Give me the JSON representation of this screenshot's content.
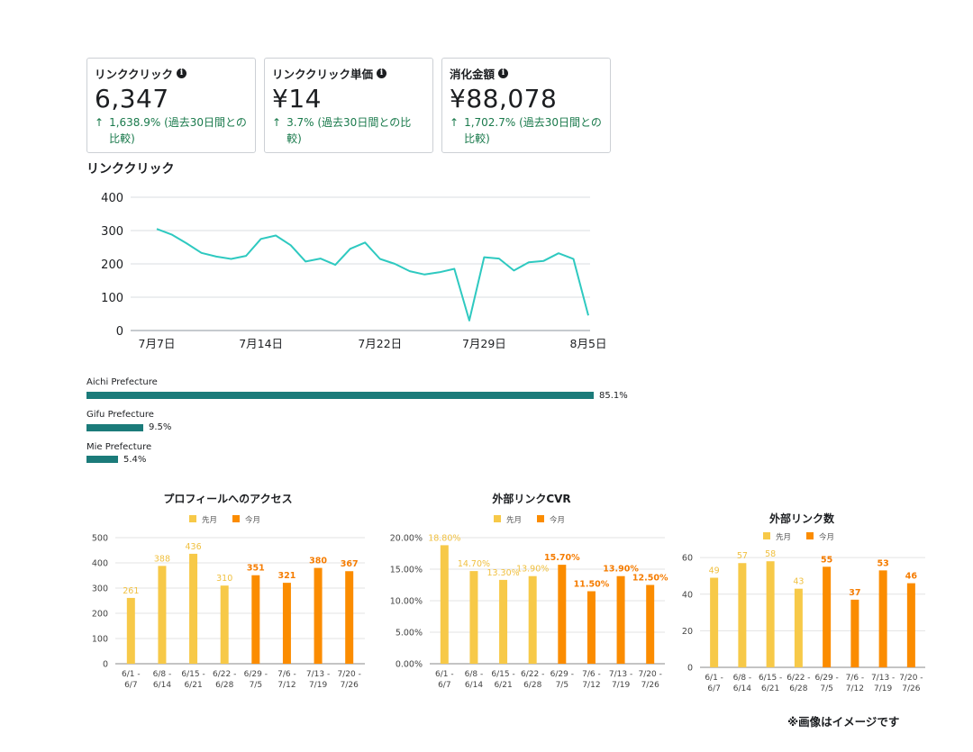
{
  "cards": [
    {
      "label": "リンククリック",
      "value": "6,347",
      "change": "1,638.9% (過去30日間との比較)"
    },
    {
      "label": "リンククリック単価",
      "value": "¥14",
      "change": "3.7% (過去30日間との比較)"
    },
    {
      "label": "消化金額",
      "value": "¥88,078",
      "change": "1,702.7% (過去30日間との比較)"
    }
  ],
  "line_section_title": "リンククリック",
  "regions": [
    {
      "name": "Aichi Prefecture",
      "pct_label": "85.1%",
      "pct": 85.1
    },
    {
      "name": "Gifu Prefecture",
      "pct_label": "9.5%",
      "pct": 9.5
    },
    {
      "name": "Mie Prefecture",
      "pct_label": "5.4%",
      "pct": 5.4
    }
  ],
  "note": "※画像はイメージです",
  "chart_data": [
    {
      "type": "line",
      "title": "リンククリック",
      "ylim": [
        0,
        400
      ],
      "yticks": [
        0,
        100,
        200,
        300,
        400
      ],
      "xtick_labels": [
        "7月7日",
        "7月14日",
        "7月22日",
        "7月29日",
        "8月5日"
      ],
      "xtick_indices": [
        0,
        7,
        15,
        22,
        29
      ],
      "color": "#2ec9c0",
      "values": [
        305,
        288,
        262,
        233,
        222,
        215,
        224,
        275,
        285,
        256,
        207,
        216,
        197,
        245,
        264,
        215,
        200,
        178,
        168,
        175,
        185,
        30,
        220,
        216,
        180,
        205,
        209,
        232,
        215,
        45
      ]
    },
    {
      "type": "bar",
      "title": "プロフィールへのアクセス",
      "legend": [
        "先月",
        "今月"
      ],
      "colors": {
        "prev": "#f7c948",
        "curr": "#fb8c00"
      },
      "categories": [
        "6/1 - 6/7",
        "6/8 - 6/14",
        "6/15 - 6/21",
        "6/22 - 6/28",
        "6/29 - 7/5",
        "7/6 - 7/12",
        "7/13 - 7/19",
        "7/20 - 7/26"
      ],
      "values": [
        261,
        388,
        436,
        310,
        351,
        321,
        380,
        367
      ],
      "labels": [
        "261",
        "388",
        "436",
        "310",
        "351",
        "321",
        "380",
        "367"
      ],
      "series_index": [
        0,
        0,
        0,
        0,
        1,
        1,
        1,
        1
      ],
      "ylim": [
        0,
        500
      ],
      "yticks": [
        "0",
        "100",
        "200",
        "300",
        "400",
        "500"
      ]
    },
    {
      "type": "bar",
      "title": "外部リンクCVR",
      "legend": [
        "先月",
        "今月"
      ],
      "colors": {
        "prev": "#f7c948",
        "curr": "#fb8c00"
      },
      "categories": [
        "6/1 - 6/7",
        "6/8 - 6/14",
        "6/15 - 6/21",
        "6/22 - 6/28",
        "6/29 - 7/5",
        "7/6 - 7/12",
        "7/13 - 7/19",
        "7/20 - 7/26"
      ],
      "values": [
        18.8,
        14.7,
        13.3,
        13.9,
        15.7,
        11.5,
        13.9,
        12.5
      ],
      "labels": [
        "18.80%",
        "14.70%",
        "13.30%",
        "13.90%",
        "15.70%",
        "11.50%",
        "13.90%",
        "12.50%"
      ],
      "series_index": [
        0,
        0,
        0,
        0,
        1,
        1,
        1,
        1
      ],
      "ylim": [
        0,
        20
      ],
      "yticks": [
        "0.00%",
        "5.00%",
        "10.00%",
        "15.00%",
        "20.00%"
      ]
    },
    {
      "type": "bar",
      "title": "外部リンク数",
      "legend": [
        "先月",
        "今月"
      ],
      "colors": {
        "prev": "#f7c948",
        "curr": "#fb8c00"
      },
      "categories": [
        "6/1 - 6/7",
        "6/8 - 6/14",
        "6/15 - 6/21",
        "6/22 - 6/28",
        "6/29 - 7/5",
        "7/6 - 7/12",
        "7/13 - 7/19",
        "7/20 - 7/26"
      ],
      "values": [
        49,
        57,
        58,
        43,
        55,
        37,
        53,
        46
      ],
      "labels": [
        "49",
        "57",
        "58",
        "43",
        "55",
        "37",
        "53",
        "46"
      ],
      "series_index": [
        0,
        0,
        0,
        0,
        1,
        1,
        1,
        1
      ],
      "ylim": [
        0,
        65
      ],
      "yticks": [
        "0",
        "20",
        "40",
        "60"
      ]
    }
  ]
}
